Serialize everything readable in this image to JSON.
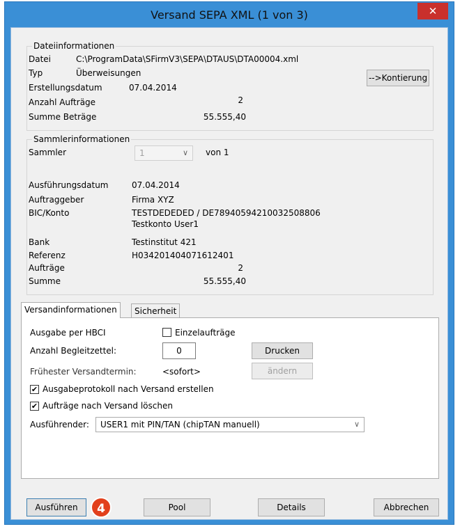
{
  "window": {
    "title": "Versand SEPA XML (1 von 3)"
  },
  "file_info": {
    "legend": "Dateiinformationen",
    "datei_label": "Datei",
    "datei_value": "C:\\ProgramData\\SFirmV3\\SEPA\\DTAUS\\DTA00004.xml",
    "typ_label": "Typ",
    "typ_value": "Überweisungen",
    "erstellungsdatum_label": "Erstellungsdatum",
    "erstellungsdatum_value": "07.04.2014",
    "anzahl_label": "Anzahl Aufträge",
    "anzahl_value": "2",
    "summe_label": "Summe Beträge",
    "summe_value": "55.555,40",
    "kontierung_button": "-->Kontierung"
  },
  "collector_info": {
    "legend": "Sammlerinformationen",
    "sammler_label": "Sammler",
    "sammler_value": "1",
    "von_label": "von 1",
    "ausfuehrungsdatum_label": "Ausführungsdatum",
    "ausfuehrungsdatum_value": "07.04.2014",
    "auftraggeber_label": "Auftraggeber",
    "auftraggeber_value": "Firma XYZ",
    "bic_label": "BIC/Konto",
    "bic_value": "TESTDEDEDED / DE78940594210032508806",
    "bic_value2": "Testkonto User1",
    "bank_label": "Bank",
    "bank_value": "Testinstitut 421",
    "referenz_label": "Referenz",
    "referenz_value": "H034201404071612401",
    "auftraege_label": "Aufträge",
    "auftraege_value": "2",
    "summe_label": "Summe",
    "summe_value": "55.555,40"
  },
  "tabs": [
    {
      "label": "Versandinformationen"
    },
    {
      "label": "Sicherheit"
    }
  ],
  "versand": {
    "ausgabe_label": "Ausgabe per HBCI",
    "einzel_label": "Einzelaufträge",
    "einzel_checked": false,
    "begleit_label": "Anzahl Begleitzettel:",
    "begleit_value": "0",
    "drucken_button": "Drucken",
    "frueh_label": "Frühester Versandtermin:",
    "frueh_value": "<sofort>",
    "aendern_button": "ändern",
    "protokoll_label": "Ausgabeprotokoll nach Versand erstellen",
    "protokoll_checked": true,
    "loeschen_label": "Aufträge nach Versand löschen",
    "loeschen_checked": true,
    "ausfuehrender_label": "Ausführender:",
    "ausfuehrender_value": "USER1 mit PIN/TAN (chipTAN manuell)"
  },
  "buttons": {
    "ausfuehren": "Ausführen",
    "pool": "Pool",
    "details": "Details",
    "abbrechen": "Abbrechen"
  },
  "step_badge": "4",
  "icons": {
    "close": "close-icon",
    "check": "check-icon",
    "chevron": "chevron-down-icon"
  }
}
